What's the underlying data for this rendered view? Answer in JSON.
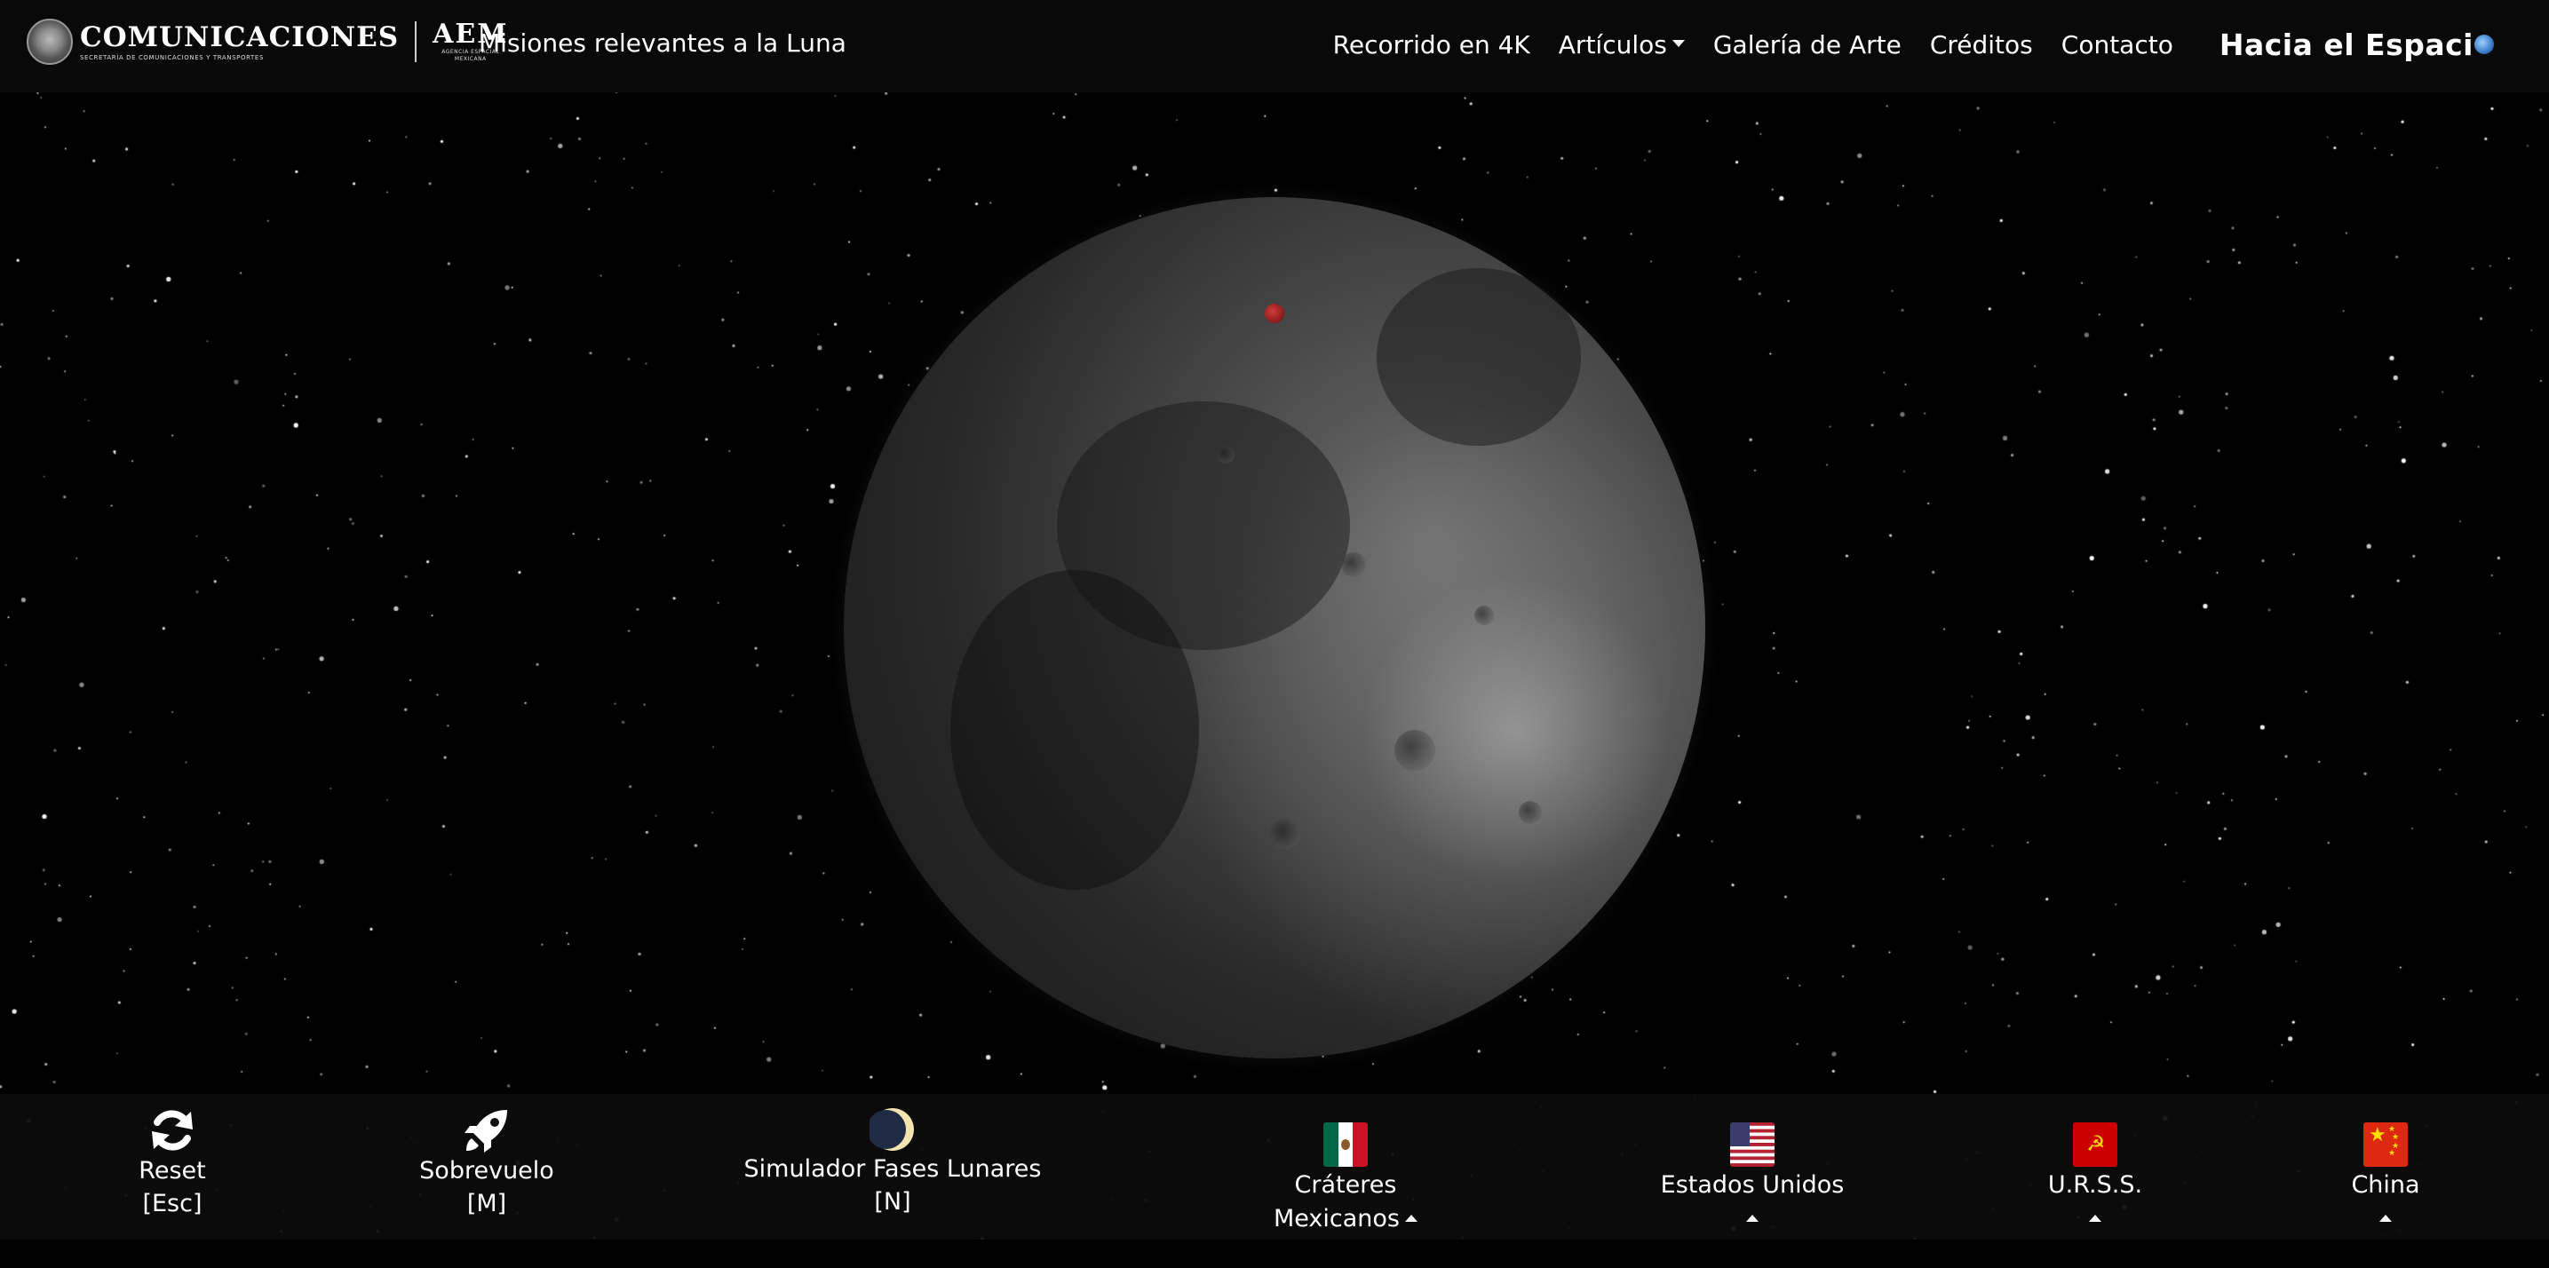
{
  "app": {
    "brand_title": "COMUNICACIONES",
    "brand_subtitle": "SECRETARÍA DE COMUNICACIONES Y TRANSPORTES",
    "aem_title": "AEM",
    "aem_subtitle": "AGENCIA ESPACIAL MEXICANA",
    "page_title": "Misiones relevantes a la Luna"
  },
  "nav": {
    "links": [
      {
        "label": "Recorrido en 4K"
      },
      {
        "label": "Artículos"
      },
      {
        "label": "Galería de Arte"
      },
      {
        "label": "Créditos"
      },
      {
        "label": "Contacto"
      }
    ],
    "logo_text": "Hacia el Espaci"
  },
  "toolbar": {
    "reset": {
      "label": "Reset",
      "hint": "[Esc]",
      "icon": "refresh-icon"
    },
    "flyby": {
      "label": "Sobrevuelo",
      "hint": "[M]",
      "icon": "rocket-icon"
    },
    "phases": {
      "label": "Simulador Fases Lunares",
      "hint": "[N]",
      "icon": "moon-phase-icon"
    },
    "mexico": {
      "label_line1": "Cráteres",
      "label_line2": "Mexicanos",
      "icon": "mexico-flag-icon"
    },
    "usa": {
      "label": "Estados Unidos",
      "icon": "usa-flag-icon"
    },
    "ussr": {
      "label": "U.R.S.S.",
      "icon": "ussr-flag-icon"
    },
    "china": {
      "label": "China",
      "icon": "china-flag-icon"
    }
  },
  "colors": {
    "background": "#000000",
    "navbar": "#090909",
    "toolbar": "#0c0c0c",
    "marker": "#c0282c",
    "accent_earth": "#3a7bc8"
  }
}
